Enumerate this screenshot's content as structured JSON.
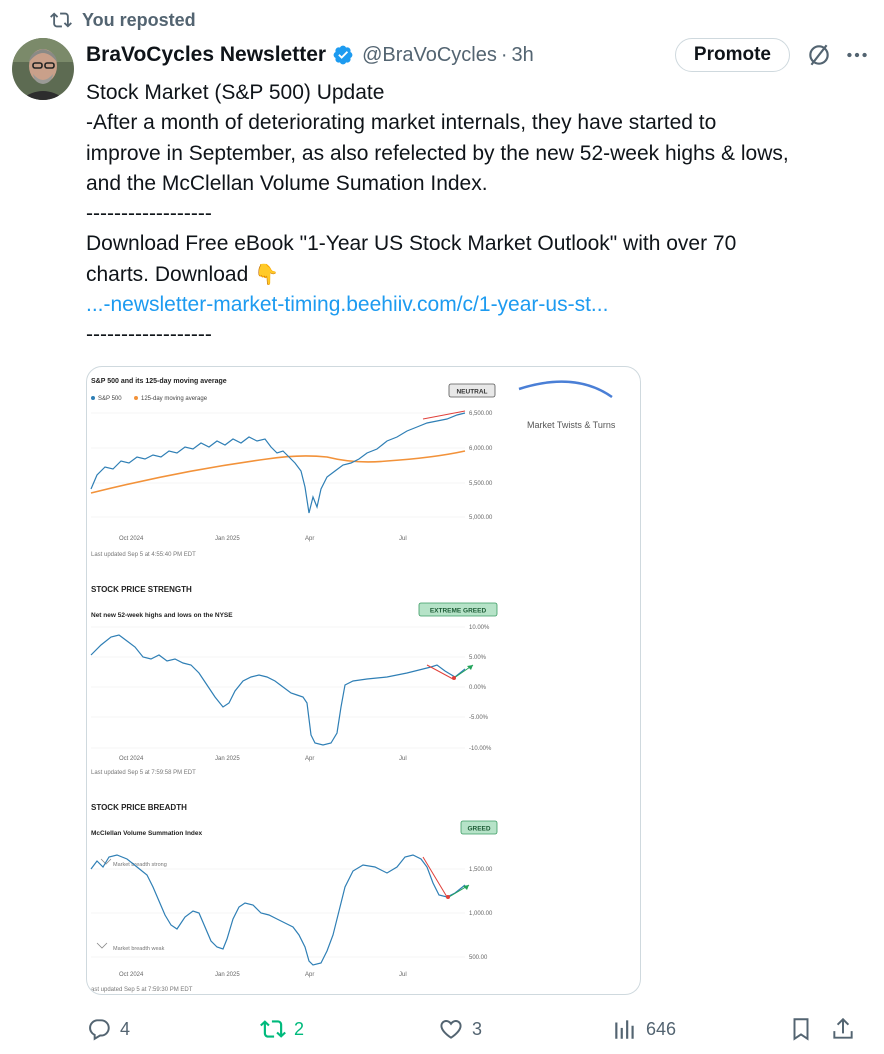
{
  "repost_banner": "You reposted",
  "author": {
    "name": "BraVoCycles Newsletter",
    "handle": "@BraVoCycles",
    "separator": "·",
    "time": "3h"
  },
  "header": {
    "promote_label": "Promote"
  },
  "post": {
    "lines": [
      "Stock Market (S&P 500) Update",
      "-After a month of deteriorating market internals, they have started to",
      "improve in September, as also refelected by the new 52-week highs & lows,",
      "and the McClellan Volume Sumation Index.",
      "------------------",
      "Download Free eBook \"1-Year US Stock Market Outlook\" with over 70",
      "charts. Download"
    ],
    "link": "...-newsletter-market-timing.beehiiv.com/c/1-year-us-st...",
    "divider_end": "------------------"
  },
  "media": {
    "brand": "Market Twists & Turns",
    "x_ticks": [
      "Oct 2024",
      "Jan 2025",
      "Apr",
      "Jul"
    ],
    "panels": [
      {
        "title": "S&P 500 and its 125-day moving average",
        "legend": [
          "S&P 500",
          "125-day moving average"
        ],
        "badge": "NEUTRAL",
        "y_ticks": [
          "6,500.00",
          "6,000.00",
          "5,500.00",
          "5,000.00"
        ],
        "updated": "Last updated Sep 5 at 4:55:40 PM EDT"
      },
      {
        "section": "STOCK PRICE STRENGTH",
        "title": "Net new 52-week highs and lows on the NYSE",
        "badge": "EXTREME GREED",
        "y_ticks": [
          "10.00%",
          "5.00%",
          "0.00%",
          "-5.00%",
          "-10.00%"
        ],
        "updated": "Last updated Sep 5 at 7:59:58 PM EDT"
      },
      {
        "section": "STOCK PRICE BREADTH",
        "title": "McClellan Volume Summation Index",
        "badge": "GREED",
        "y_ticks": [
          "1,500.00",
          "1,000.00",
          "500.00"
        ],
        "annotation_strong": "Market breadth strong",
        "annotation_weak": "Market breadth weak",
        "updated": "ast updated Sep 5 at 7:59:30 PM EDT"
      }
    ]
  },
  "actions": {
    "replies": "4",
    "reposts": "2",
    "likes": "3",
    "views": "646"
  },
  "colors": {
    "accent": "#1d9bf0",
    "repost_green": "#00ba7c",
    "line_blue": "#2f7fb5",
    "ma_orange": "#f2923a"
  }
}
